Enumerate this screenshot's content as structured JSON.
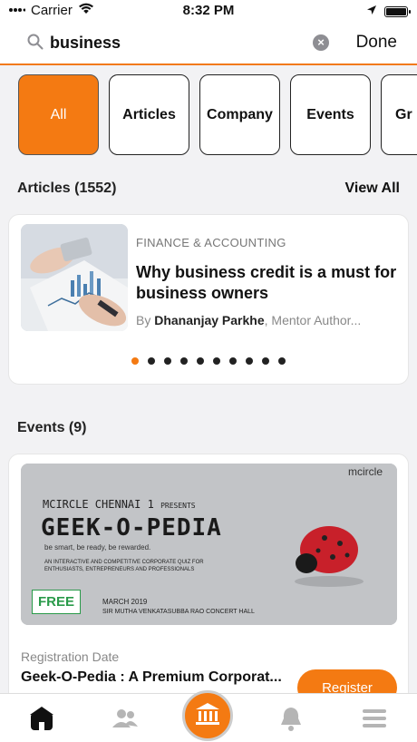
{
  "status": {
    "carrier": "Carrier",
    "time": "8:32 PM"
  },
  "search": {
    "query": "business",
    "placeholder": "Search",
    "done_label": "Done"
  },
  "filters": [
    "All",
    "Articles",
    "Company",
    "Events",
    "Gr"
  ],
  "articles": {
    "title": "Articles (1552)",
    "view_all": "View All",
    "item": {
      "category": "FINANCE & ACCOUNTING",
      "title": "Why business credit is a must for business owners",
      "by": "By",
      "author": "Dhananjay Parkhe",
      "author_suffix": ", Mentor Author..."
    },
    "page_count": 10,
    "active_page": 1
  },
  "events": {
    "title": "Events (9)",
    "item": {
      "poster": {
        "brand": "mcircle",
        "presenter": "MCIRCLE CHENNAI 1",
        "presents": "PRESENTS",
        "name": "GEEK-O-PEDIA",
        "tagline": "be smart, be ready, be rewarded.",
        "desc1": "AN INTERACTIVE AND COMPETITIVE CORPORATE QUIZ FOR",
        "desc2": "ENTHUSIASTS, ENTREPRENEURS AND PROFESSIONALS",
        "date": "MARCH 2019",
        "venue": "SIR MUTHA VENKATASUBBA RAO CONCERT HALL"
      },
      "badge": "FREE",
      "reg_label": "Registration Date",
      "title": "Geek-O-Pedia : A Premium Corporat...",
      "register_label": "Register"
    }
  },
  "tabbar": {
    "items": [
      "home-icon",
      "people-icon",
      "institution-icon",
      "bell-icon",
      "menu-icon"
    ]
  },
  "colors": {
    "accent": "#f47a12",
    "free": "#2a9a4a"
  }
}
